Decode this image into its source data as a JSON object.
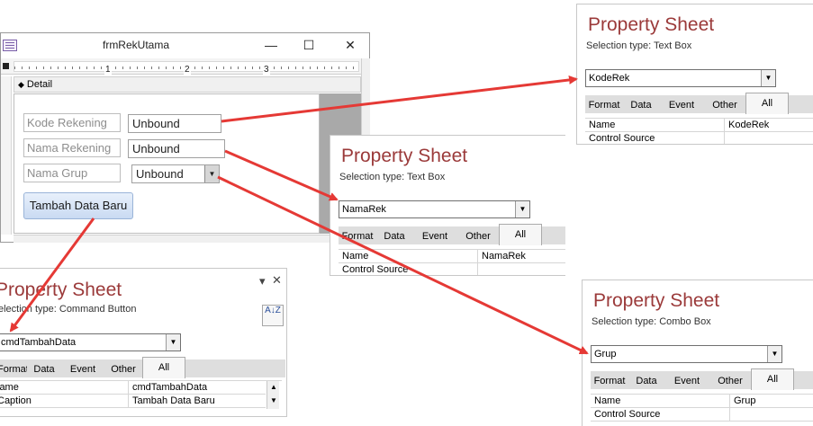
{
  "form": {
    "title": "frmRekUtama",
    "minimize_label": "—",
    "maximize_label": "☐",
    "close_label": "✕",
    "ruler_numbers": [
      "1",
      "2",
      "3"
    ],
    "section_label": "Detail",
    "labels": {
      "kode": "Kode Rekening",
      "nama": "Nama Rekening",
      "grup": "Nama Grup"
    },
    "textboxes": {
      "kode": "Unbound",
      "nama": "Unbound",
      "grup": "Unbound"
    },
    "command_button": "Tambah Data Baru"
  },
  "sheets": {
    "kode": {
      "title": "Property Sheet",
      "selection_type": "Selection type:  Text Box",
      "control": "KodeRek",
      "tabs": [
        "Format",
        "Data",
        "Event",
        "Other",
        "All"
      ],
      "active_tab": "All",
      "rows": [
        {
          "name": "Name",
          "value": "KodeRek"
        },
        {
          "name": "Control Source",
          "value": ""
        }
      ]
    },
    "nama": {
      "title": "Property Sheet",
      "selection_type": "Selection type:  Text Box",
      "control": "NamaRek",
      "tabs": [
        "Format",
        "Data",
        "Event",
        "Other",
        "All"
      ],
      "active_tab": "All",
      "rows": [
        {
          "name": "Name",
          "value": "NamaRek"
        },
        {
          "name": "Control Source",
          "value": ""
        }
      ]
    },
    "cmd": {
      "title": "Property Sheet",
      "selection_type": "election type:  Command Button",
      "control": "cmdTambahData",
      "tabs": [
        "Format",
        "Data",
        "Event",
        "Other",
        "All"
      ],
      "active_tab": "All",
      "rows": [
        {
          "name": "lame",
          "value": "cmdTambahData"
        },
        {
          "name": "Caption",
          "value": "Tambah Data Baru"
        }
      ],
      "close_label": "✕",
      "pin_label": "▾",
      "sort_label": "A↓Z"
    },
    "grup": {
      "title": "Property Sheet",
      "selection_type": "Selection type:  Combo Box",
      "control": "Grup",
      "tabs": [
        "Format",
        "Data",
        "Event",
        "Other",
        "All"
      ],
      "active_tab": "All",
      "rows": [
        {
          "name": "Name",
          "value": "Grup"
        },
        {
          "name": "Control Source",
          "value": ""
        }
      ]
    }
  },
  "colors": {
    "arrow": "#e53935",
    "title": "#9b3a3a"
  }
}
